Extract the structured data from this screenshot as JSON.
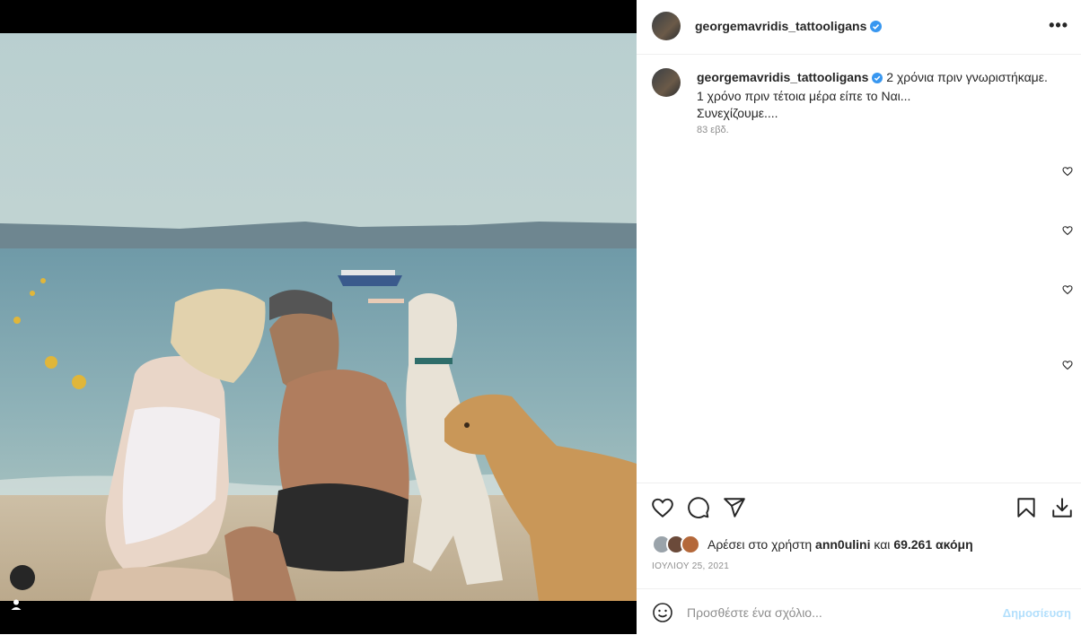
{
  "post": {
    "username": "georgemavridis_tattooligans",
    "caption_line1": "2 χρόνια πριν γνωριστήκαμε.",
    "caption_line2": "1 χρόνο πριν τέτοια μέρα είπε το Ναι...",
    "caption_line3": "Συνεχίζουμε....",
    "caption_ago": "83 εβδ.",
    "likes_prefix": "Αρέσει στο χρήστη",
    "likes_user": "ann0ulini",
    "likes_and": "και",
    "likes_count": "69.261 ακόμη",
    "date": "ΙΟΥΛΙΟΥ 25, 2021"
  },
  "comment": {
    "placeholder": "Προσθέστε ένα σχόλιο...",
    "post_label": "Δημοσίευση"
  },
  "icons": {
    "more": "more-options-icon",
    "like": "heart-icon",
    "comment": "comment-icon",
    "share": "send-icon",
    "save": "bookmark-icon",
    "download": "download-icon",
    "emoji": "emoji-icon",
    "tag": "user-tag-icon",
    "verified": "verified-badge-icon"
  },
  "colors": {
    "verified": "#3897f0",
    "post_button": "#b2dffc",
    "muted": "#8e8e8e"
  }
}
